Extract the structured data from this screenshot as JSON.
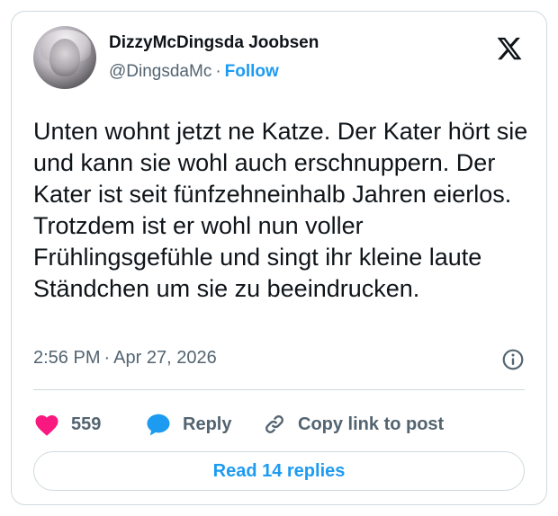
{
  "author": {
    "display_name": "DizzyMcDingsda Joobsen",
    "handle": "@DingsdaMc",
    "separator": "·",
    "follow_label": "Follow"
  },
  "tweet": {
    "text": "Unten wohnt jetzt ne Katze. Der Kater hört sie und kann sie wohl auch erschnuppern. Der Kater ist seit fünfzehneinhalb Jahren eierlos. Trotzdem ist er wohl nun voller Frühlingsgefühle und singt ihr kleine laute Ständchen um sie zu beeindrucken.",
    "time": "2:56 PM",
    "date_separator": "·",
    "date": "Apr 27, 2026"
  },
  "actions": {
    "like_count": "559",
    "reply_label": "Reply",
    "copy_label": "Copy link to post"
  },
  "read_replies_label": "Read 14 replies",
  "icons": {
    "x_logo": "x-logo-icon",
    "info": "info-icon",
    "like": "heart-icon",
    "reply": "reply-bubble-icon",
    "copy": "link-icon"
  },
  "colors": {
    "accent": "#1d9bf0",
    "heart": "#f91880",
    "secondary_text": "#536471",
    "border": "#cfd9de"
  }
}
